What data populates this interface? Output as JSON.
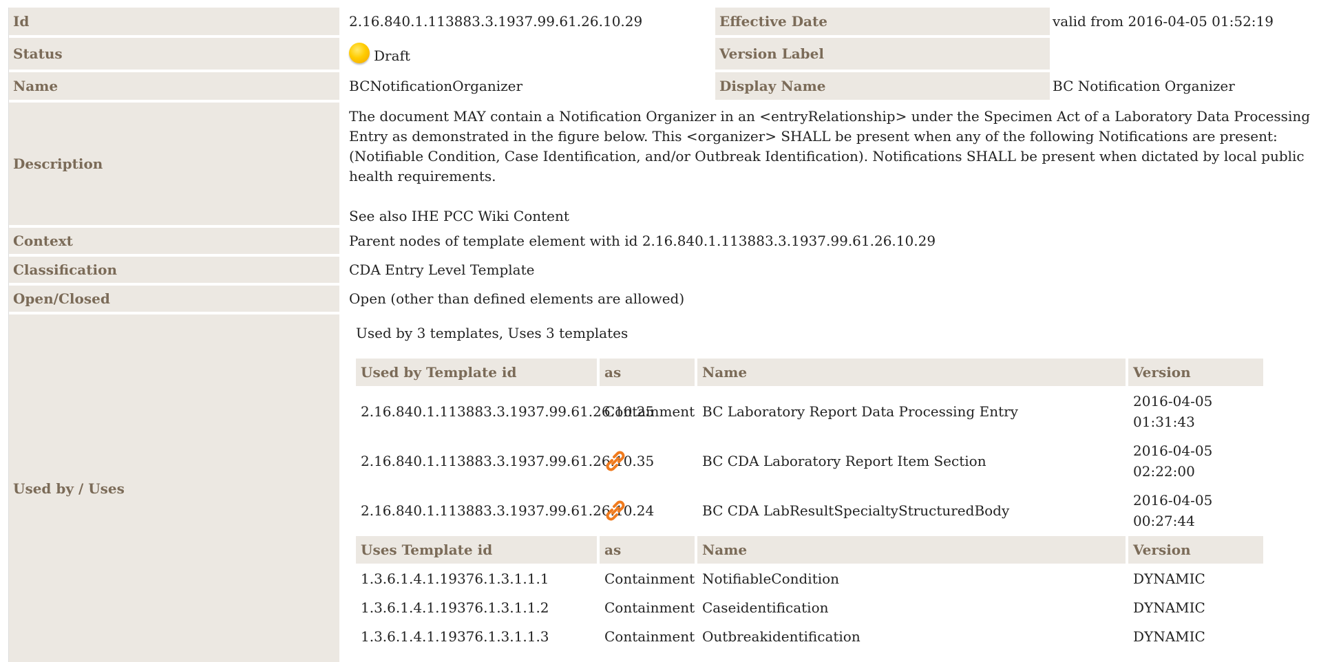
{
  "template": {
    "id_label": "Id",
    "id_value": "2.16.840.1.113883.3.1937.99.61.26.10.29",
    "effective_date_label": "Effective Date",
    "effective_date_value": "valid from 2016-04-05 01:52:19",
    "status_label": "Status",
    "status_value": "Draft",
    "version_label_label": "Version Label",
    "version_label_value": "",
    "name_label": "Name",
    "name_value": "BCNotificationOrganizer",
    "display_name_label": "Display Name",
    "display_name_value": "BC Notification Organizer",
    "description_label": "Description",
    "description_text": "The document MAY contain a Notification Organizer in an <entryRelationship> under the Specimen Act of a Laboratory Data Processing Entry as demonstrated in the figure below. This <organizer> SHALL be present when any of the following Notifications are present:(Notifiable Condition, Case Identification, and/or Outbreak Identification). Notifications SHALL be present when dictated by local public health requirements.",
    "description_see_also": "See also IHE PCC Wiki Content",
    "context_label": "Context",
    "context_value": "Parent nodes of template element with id 2.16.840.1.113883.3.1937.99.61.26.10.29",
    "classification_label": "Classification",
    "classification_value": "CDA Entry Level Template",
    "open_closed_label": "Open/Closed",
    "open_closed_value": "Open (other than defined elements are allowed)",
    "used_by_label": "Used by / Uses"
  },
  "usage": {
    "summary": "Used by 3 templates, Uses 3 templates",
    "used_by_headers": {
      "id": "Used by Template id",
      "as": "as",
      "name": "Name",
      "version": "Version"
    },
    "used_by_rows": [
      {
        "id": "2.16.840.1.113883.3.1937.99.61.26.10.25",
        "as": "Containment",
        "name": "BC Laboratory Report Data Processing Entry",
        "version_date": "2016-04-05",
        "version_time": "01:31:43"
      },
      {
        "id": "2.16.840.1.113883.3.1937.99.61.26.10.35",
        "as": "",
        "as_icon": "link-icon",
        "name": "BC CDA Laboratory Report Item Section",
        "version_date": "2016-04-05",
        "version_time": "02:22:00"
      },
      {
        "id": "2.16.840.1.113883.3.1937.99.61.26.10.24",
        "as": "",
        "as_icon": "link-icon",
        "name": "BC CDA LabResultSpecialtyStructuredBody",
        "version_date": "2016-04-05",
        "version_time": "00:27:44"
      }
    ],
    "uses_headers": {
      "id": "Uses Template id",
      "as": "as",
      "name": "Name",
      "version": "Version"
    },
    "uses_rows": [
      {
        "id": "1.3.6.1.4.1.19376.1.3.1.1.1",
        "as": "Containment",
        "name": "NotifiableCondition",
        "version": "DYNAMIC"
      },
      {
        "id": "1.3.6.1.4.1.19376.1.3.1.1.2",
        "as": "Containment",
        "name": "Caseidentification",
        "version": "DYNAMIC"
      },
      {
        "id": "1.3.6.1.4.1.19376.1.3.1.1.3",
        "as": "Containment",
        "name": "Outbreakidentification",
        "version": "DYNAMIC"
      }
    ]
  },
  "colors": {
    "label_bg": "#ece8e2",
    "label_text": "#7b6b58",
    "status_dot": "#ffcc00",
    "link_icon": "#f07b1e"
  }
}
